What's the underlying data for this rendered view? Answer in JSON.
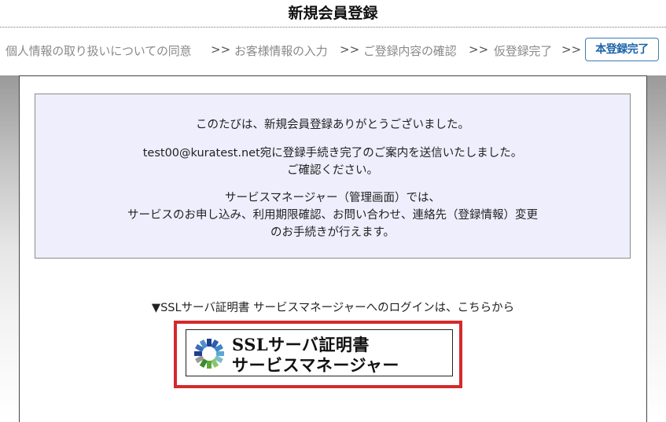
{
  "header": {
    "title": "新規会員登録"
  },
  "steps": {
    "items": [
      "個人情報の取り扱いについての同意",
      "お客様情報の入力",
      "ご登録内容の確認",
      "仮登録完了"
    ],
    "separator": ">>",
    "current": "本登録完了"
  },
  "message": {
    "thanks": "このたびは、新規会員登録ありがとうございました。",
    "sent_line1": "test00@kuratest.net宛に登録手続き完了のご案内を送信いたしました。",
    "sent_line2": "ご確認ください。",
    "manager_line1": "サービスマネージャー（管理画面）では、",
    "manager_line2": "サービスのお申し込み、利用期限確認、お問い合わせ、連絡先（登録情報）変更",
    "manager_line3": "のお手続きが行えます。"
  },
  "login": {
    "text": "▼SSLサーバ証明書 サービスマネージャーへのログインは、こちらから",
    "banner_line1": "SSLサーバ証明書",
    "banner_line2": "サービスマネージャー",
    "highlight_color": "#d42a2a"
  },
  "icons": {
    "banner_logo": "ssl-sunburst-logo-icon"
  }
}
